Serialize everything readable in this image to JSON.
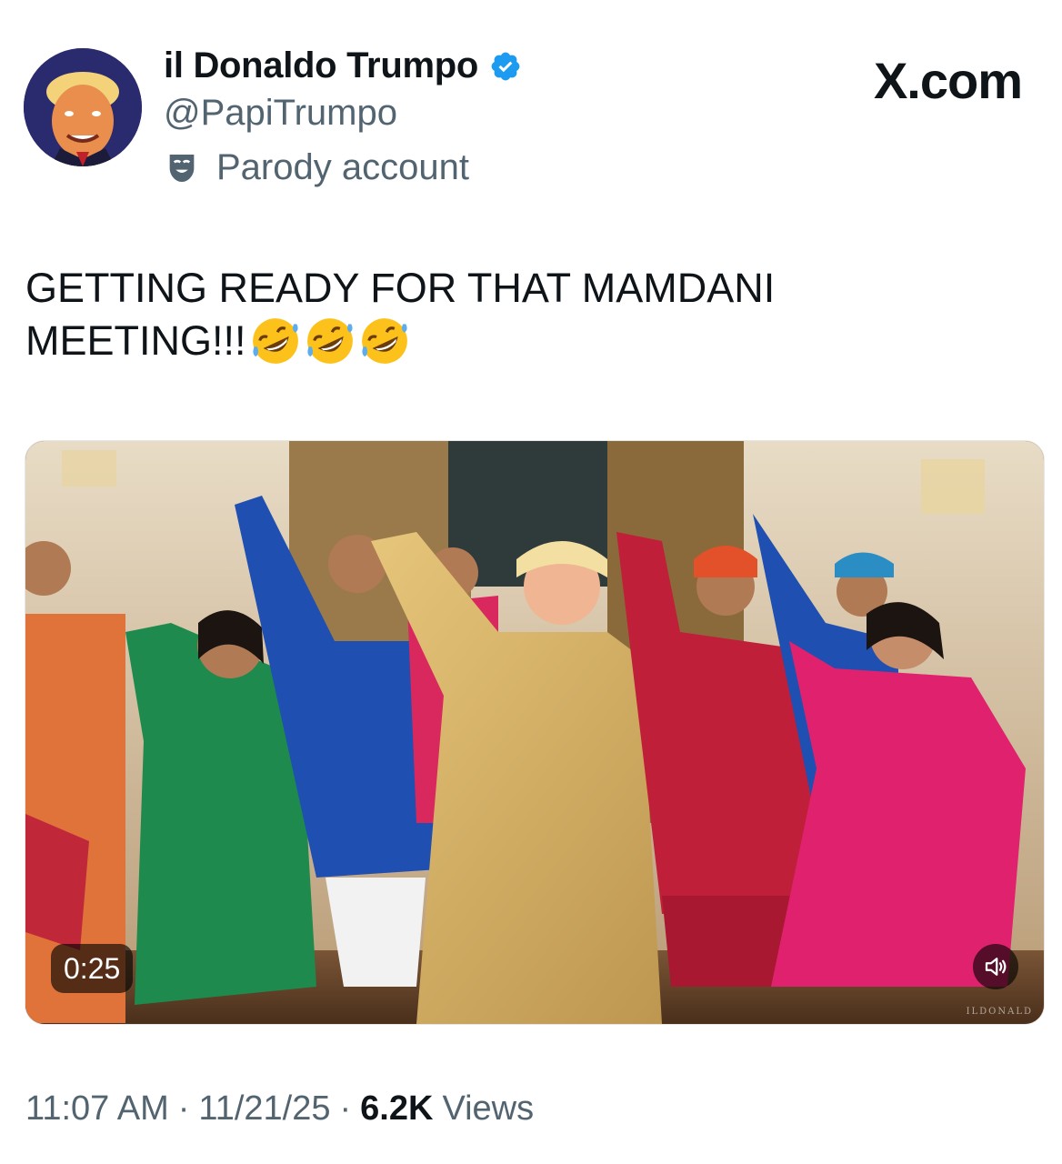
{
  "header": {
    "display_name": "il Donaldo Trumpo",
    "handle": "@PapiTrumpo",
    "parody_label": "Parody account",
    "brand": "X.com",
    "verified_color": "#1d9bf0"
  },
  "tweet": {
    "text_line1": "GETTING READY FOR THAT MAMDANI",
    "text_line2": "MEETING!!!",
    "emoji": [
      "rolling-on-floor-laughing",
      "rolling-on-floor-laughing",
      "rolling-on-floor-laughing"
    ]
  },
  "media": {
    "type": "video",
    "duration": "0:25",
    "watermark": "ILDONALD",
    "mute_icon": "speaker-icon"
  },
  "meta": {
    "time": "11:07 AM",
    "separator": "·",
    "date": "11/21/25",
    "views_count": "6.2K",
    "views_label": "Views"
  },
  "colors": {
    "text_primary": "#0f1419",
    "text_secondary": "#536471",
    "accent": "#1d9bf0"
  }
}
